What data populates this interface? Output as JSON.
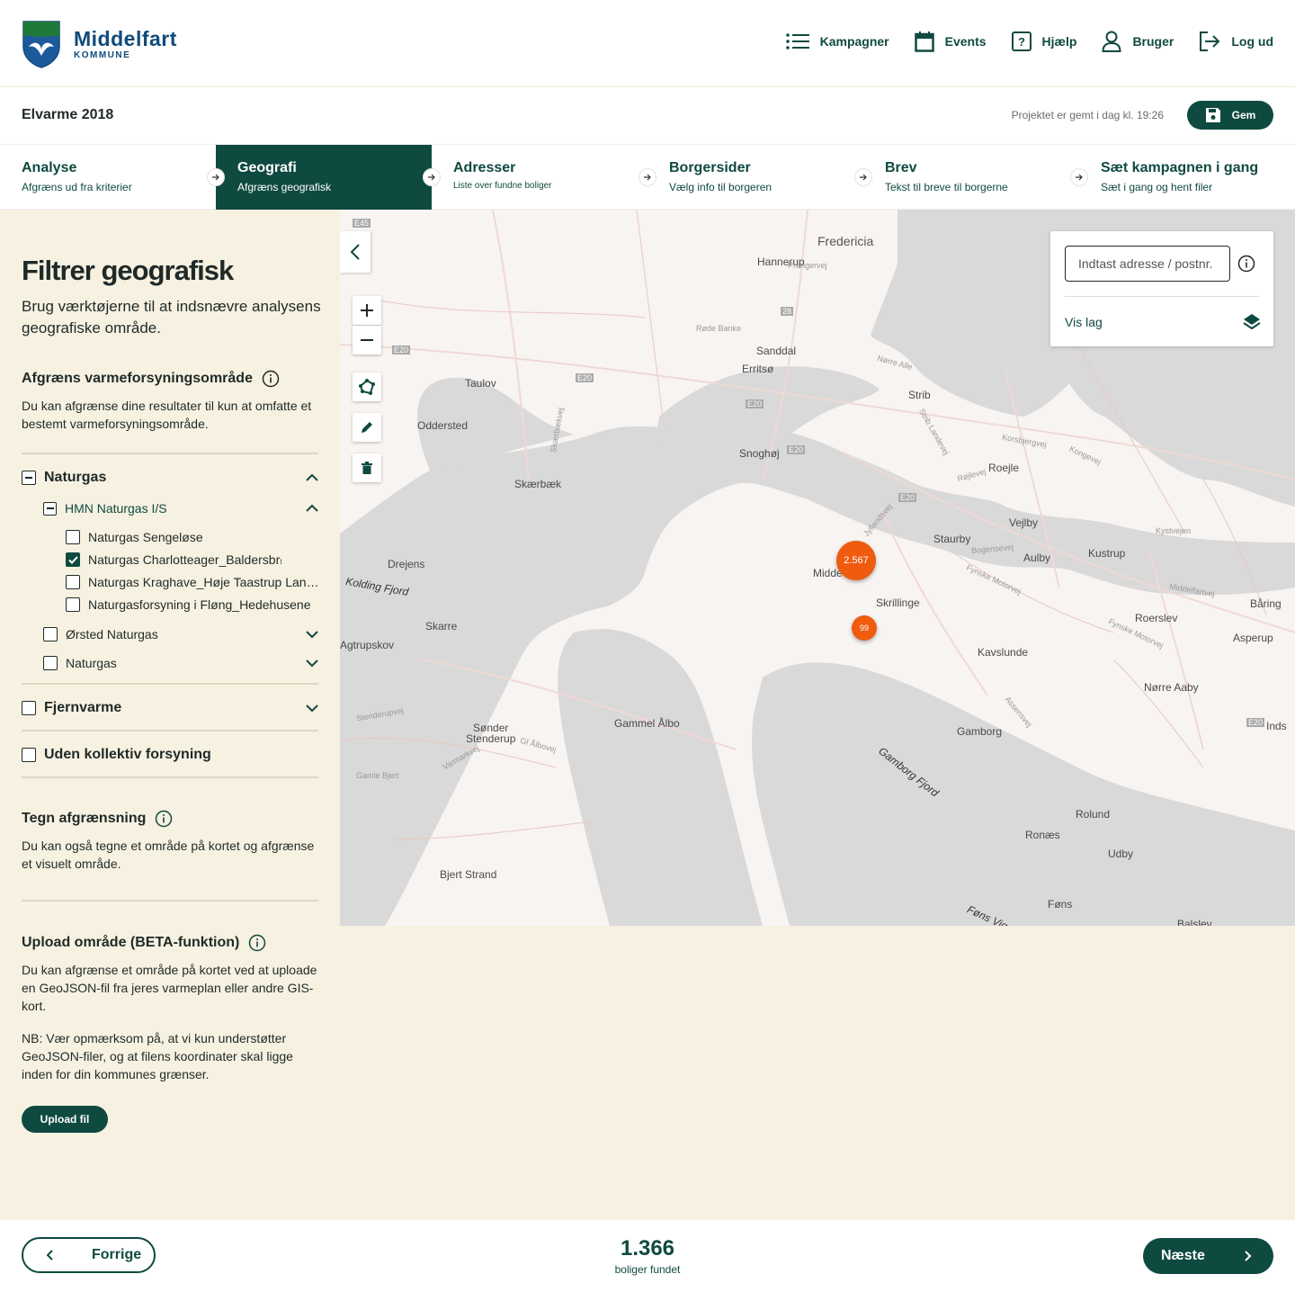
{
  "brand": {
    "name": "Middelfart",
    "sub": "KOMMUNE"
  },
  "nav": {
    "kampagner": "Kampagner",
    "events": "Events",
    "hjaelp": "Hjælp",
    "bruger": "Bruger",
    "logud": "Log ud"
  },
  "project": {
    "title": "Elvarme 2018",
    "saved": "Projektet er gemt i dag kl. 19:26",
    "save_label": "Gem"
  },
  "steps": [
    {
      "title": "Analyse",
      "sub": "Afgræns ud fra kriterier"
    },
    {
      "title": "Geografi",
      "sub": "Afgræns geografisk"
    },
    {
      "title": "Adresser",
      "sub": "Liste over fundne boliger"
    },
    {
      "title": "Borgersider",
      "sub": "Vælg info til borgeren"
    },
    {
      "title": "Brev",
      "sub": "Tekst til breve til borgerne"
    },
    {
      "title": "Sæt kampagnen i gang",
      "sub": "Sæt i gang og hent filer"
    }
  ],
  "panel": {
    "title": "Filtrer geografisk",
    "lead": "Brug værktøjerne til at indsnævre analysens geografiske område.",
    "section1": {
      "title": "Afgræns varmeforsyningsområde",
      "text": "Du kan afgrænse dine resultater til kun at omfatte et bestemt varmeforsyningsområde."
    },
    "tree": {
      "naturgas": "Naturgas",
      "hmn": "HMN Naturgas I/S",
      "items": [
        "Naturgas Sengeløse",
        "Naturgas Charlotteager_Baldersbrønde",
        "Naturgas Kraghave_Høje Taastrup Landsby",
        "Naturgasforsyning i Fløng_Hedehusene"
      ],
      "orsted": "Ørsted Naturgas",
      "naturgas2": "Naturgas",
      "fjernvarme": "Fjernvarme",
      "uden": "Uden kollektiv forsyning"
    },
    "section2": {
      "title": "Tegn afgrænsning",
      "text": "Du kan også tegne et område på kortet og afgrænse et visuelt område."
    },
    "section3": {
      "title": "Upload område (BETA-funktion)",
      "text": "Du kan afgrænse et område på kortet ved at uploade en GeoJSON-fil fra jeres varmeplan eller andre GIS-kort.",
      "note": "NB: Vær opmærksom på, at vi kun understøtter GeoJSON-filer, og at filens koordinater skal ligge inden for din kommunes grænser.",
      "button": "Upload fil"
    }
  },
  "map": {
    "search_placeholder": "Indtast adresse / postnr.",
    "layers": "Vis lag",
    "clusters": [
      "2.567",
      "99"
    ],
    "labels": {
      "fredericia": "Fredericia",
      "hannerup": "Hannerup",
      "prangervej": "Prangervej",
      "taulov": "Taulov",
      "sanddal": "Sanddal",
      "erritso": "Erritsø",
      "strib": "Strib",
      "oddersted": "Oddersted",
      "snoghoj": "Snoghøj",
      "roejle": "Roejle",
      "skaerbaek": "Skærbæk",
      "vejlby": "Vejlby",
      "staurby": "Staurby",
      "aulby": "Aulby",
      "kustrup": "Kustrup",
      "drejens": "Drejens",
      "kolding_fjord": "Kolding Fjord",
      "midde": "Midde",
      "skrillinge": "Skrillinge",
      "roerslev": "Roerslev",
      "baring": "Båring",
      "asperup": "Asperup",
      "skarre": "Skarre",
      "agtrupskov": "Agtrupskov",
      "kavslunde": "Kavslunde",
      "norre_aaby": "Nørre Aaby",
      "gammel_albo": "Gammel Ålbo",
      "sonder_stenderup": "Sønder\nStenderup",
      "gamborg": "Gamborg",
      "gamborg_fjord": "Gamborg Fjord",
      "rolund": "Rolund",
      "ronaes": "Ronæs",
      "udby": "Udby",
      "bjert_strand": "Bjert Strand",
      "fons": "Føns",
      "balslev": "Balslev",
      "inds": "Inds",
      "rode_banke": "Røde Banke",
      "norre_alle": "Nørre Alle",
      "fynske_motorvej": "Fynske Motorvej",
      "fynske_motorvej2": "Fynske Motorvej",
      "bogensevej": "Bogensevej",
      "korsbjergvej": "Korsbjergvej",
      "kongevej": "Kongevej",
      "middelfartvej": "Middelfartvej",
      "kystvejen": "Kystvejen",
      "assensvej": "Assensvej",
      "stenderupvej": "Stenderupvej",
      "varmarkvej": "Varmarkvej",
      "gl_albovej": "Gl Ålbovej",
      "gamle_bjert": "Gamle Bjert",
      "fons_vig": "Føns Vig",
      "jyllandsvej": "Jyllandsvej",
      "rojlevej": "Røjlevej",
      "skaerbaekvej": "Skærbækvej",
      "strib_landevej": "Strib Landevej",
      "e20": "E20",
      "e45": "E45",
      "r28": "28"
    }
  },
  "bottom": {
    "prev": "Forrige",
    "next": "Næste",
    "count": "1.366",
    "count_label": "boliger fundet"
  }
}
